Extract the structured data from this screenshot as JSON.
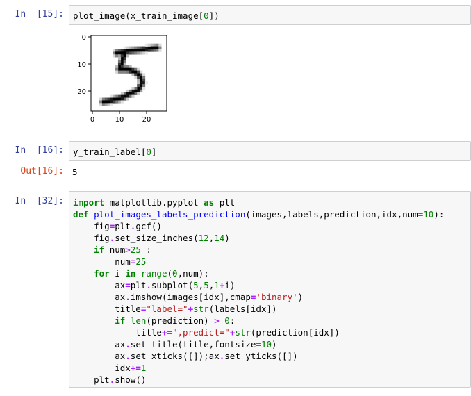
{
  "cells": [
    {
      "prompt": "In  [15]:",
      "tokens": [
        {
          "t": "plot_image",
          "c": "pl"
        },
        {
          "t": "(",
          "c": "pl"
        },
        {
          "t": "x_train_image",
          "c": "pl"
        },
        {
          "t": "[",
          "c": "pl"
        },
        {
          "t": "0",
          "c": "num"
        },
        {
          "t": "])",
          "c": "pl"
        }
      ]
    },
    {
      "prompt": "In  [16]:",
      "tokens": [
        {
          "t": "y_train_label",
          "c": "pl"
        },
        {
          "t": "[",
          "c": "pl"
        },
        {
          "t": "0",
          "c": "num"
        },
        {
          "t": "]",
          "c": "pl"
        }
      ]
    },
    {
      "prompt": "In  [32]:",
      "tokens": [
        {
          "t": "import",
          "c": "kw"
        },
        {
          "t": " matplotlib.pyplot ",
          "c": "pl"
        },
        {
          "t": "as",
          "c": "kw"
        },
        {
          "t": " plt\n",
          "c": "pl"
        },
        {
          "t": "def",
          "c": "kw"
        },
        {
          "t": " ",
          "c": "pl"
        },
        {
          "t": "plot_images_labels_prediction",
          "c": "fn"
        },
        {
          "t": "(images,labels,prediction,idx,num",
          "c": "pl"
        },
        {
          "t": "=",
          "c": "op"
        },
        {
          "t": "10",
          "c": "num"
        },
        {
          "t": "):\n",
          "c": "pl"
        },
        {
          "t": "    fig",
          "c": "pl"
        },
        {
          "t": "=",
          "c": "op"
        },
        {
          "t": "plt",
          "c": "pl"
        },
        {
          "t": ".",
          "c": "op"
        },
        {
          "t": "gcf()\n",
          "c": "pl"
        },
        {
          "t": "    fig",
          "c": "pl"
        },
        {
          "t": ".",
          "c": "op"
        },
        {
          "t": "set_size_inches(",
          "c": "pl"
        },
        {
          "t": "12",
          "c": "num"
        },
        {
          "t": ",",
          "c": "pl"
        },
        {
          "t": "14",
          "c": "num"
        },
        {
          "t": ")\n",
          "c": "pl"
        },
        {
          "t": "    ",
          "c": "pl"
        },
        {
          "t": "if",
          "c": "kw"
        },
        {
          "t": " num",
          "c": "pl"
        },
        {
          "t": ">",
          "c": "op"
        },
        {
          "t": "25",
          "c": "num"
        },
        {
          "t": " :\n",
          "c": "pl"
        },
        {
          "t": "        num",
          "c": "pl"
        },
        {
          "t": "=",
          "c": "op"
        },
        {
          "t": "25",
          "c": "num"
        },
        {
          "t": "\n",
          "c": "pl"
        },
        {
          "t": "    ",
          "c": "pl"
        },
        {
          "t": "for",
          "c": "kw"
        },
        {
          "t": " i ",
          "c": "pl"
        },
        {
          "t": "in",
          "c": "kw"
        },
        {
          "t": " ",
          "c": "pl"
        },
        {
          "t": "range",
          "c": "bi"
        },
        {
          "t": "(",
          "c": "pl"
        },
        {
          "t": "0",
          "c": "num"
        },
        {
          "t": ",num):\n",
          "c": "pl"
        },
        {
          "t": "        ax",
          "c": "pl"
        },
        {
          "t": "=",
          "c": "op"
        },
        {
          "t": "plt",
          "c": "pl"
        },
        {
          "t": ".",
          "c": "op"
        },
        {
          "t": "subplot(",
          "c": "pl"
        },
        {
          "t": "5",
          "c": "num"
        },
        {
          "t": ",",
          "c": "pl"
        },
        {
          "t": "5",
          "c": "num"
        },
        {
          "t": ",",
          "c": "pl"
        },
        {
          "t": "1",
          "c": "num"
        },
        {
          "t": "+",
          "c": "op"
        },
        {
          "t": "i)\n",
          "c": "pl"
        },
        {
          "t": "        ax",
          "c": "pl"
        },
        {
          "t": ".",
          "c": "op"
        },
        {
          "t": "imshow(images[idx],cmap",
          "c": "pl"
        },
        {
          "t": "=",
          "c": "op"
        },
        {
          "t": "'binary'",
          "c": "str"
        },
        {
          "t": ")\n",
          "c": "pl"
        },
        {
          "t": "        title",
          "c": "pl"
        },
        {
          "t": "=",
          "c": "op"
        },
        {
          "t": "\"label=\"",
          "c": "str"
        },
        {
          "t": "+",
          "c": "op"
        },
        {
          "t": "str",
          "c": "bi"
        },
        {
          "t": "(labels[idx])\n",
          "c": "pl"
        },
        {
          "t": "        ",
          "c": "pl"
        },
        {
          "t": "if",
          "c": "kw"
        },
        {
          "t": " ",
          "c": "pl"
        },
        {
          "t": "len",
          "c": "bi"
        },
        {
          "t": "(prediction) ",
          "c": "pl"
        },
        {
          "t": ">",
          "c": "op"
        },
        {
          "t": " ",
          "c": "pl"
        },
        {
          "t": "0",
          "c": "num"
        },
        {
          "t": ":\n",
          "c": "pl"
        },
        {
          "t": "            title",
          "c": "pl"
        },
        {
          "t": "+=",
          "c": "op"
        },
        {
          "t": "\",predict=\"",
          "c": "str"
        },
        {
          "t": "+",
          "c": "op"
        },
        {
          "t": "str",
          "c": "bi"
        },
        {
          "t": "(prediction[idx])\n",
          "c": "pl"
        },
        {
          "t": "        ax",
          "c": "pl"
        },
        {
          "t": ".",
          "c": "op"
        },
        {
          "t": "set_title(title,fontsize",
          "c": "pl"
        },
        {
          "t": "=",
          "c": "op"
        },
        {
          "t": "10",
          "c": "num"
        },
        {
          "t": ")\n",
          "c": "pl"
        },
        {
          "t": "        ax",
          "c": "pl"
        },
        {
          "t": ".",
          "c": "op"
        },
        {
          "t": "set_xticks([]);ax",
          "c": "pl"
        },
        {
          "t": ".",
          "c": "op"
        },
        {
          "t": "set_yticks([])\n",
          "c": "pl"
        },
        {
          "t": "        idx",
          "c": "pl"
        },
        {
          "t": "+=",
          "c": "op"
        },
        {
          "t": "1",
          "c": "num"
        },
        {
          "t": "\n",
          "c": "pl"
        },
        {
          "t": "    plt",
          "c": "pl"
        },
        {
          "t": ".",
          "c": "op"
        },
        {
          "t": "show()",
          "c": "pl"
        }
      ]
    }
  ],
  "outputs": {
    "cell16_prompt": "Out[16]:",
    "cell16_value": "5"
  },
  "plot": {
    "xticks": [
      "0",
      "10",
      "20"
    ],
    "yticks": [
      "0",
      "10",
      "20"
    ],
    "digit_label": "5"
  }
}
